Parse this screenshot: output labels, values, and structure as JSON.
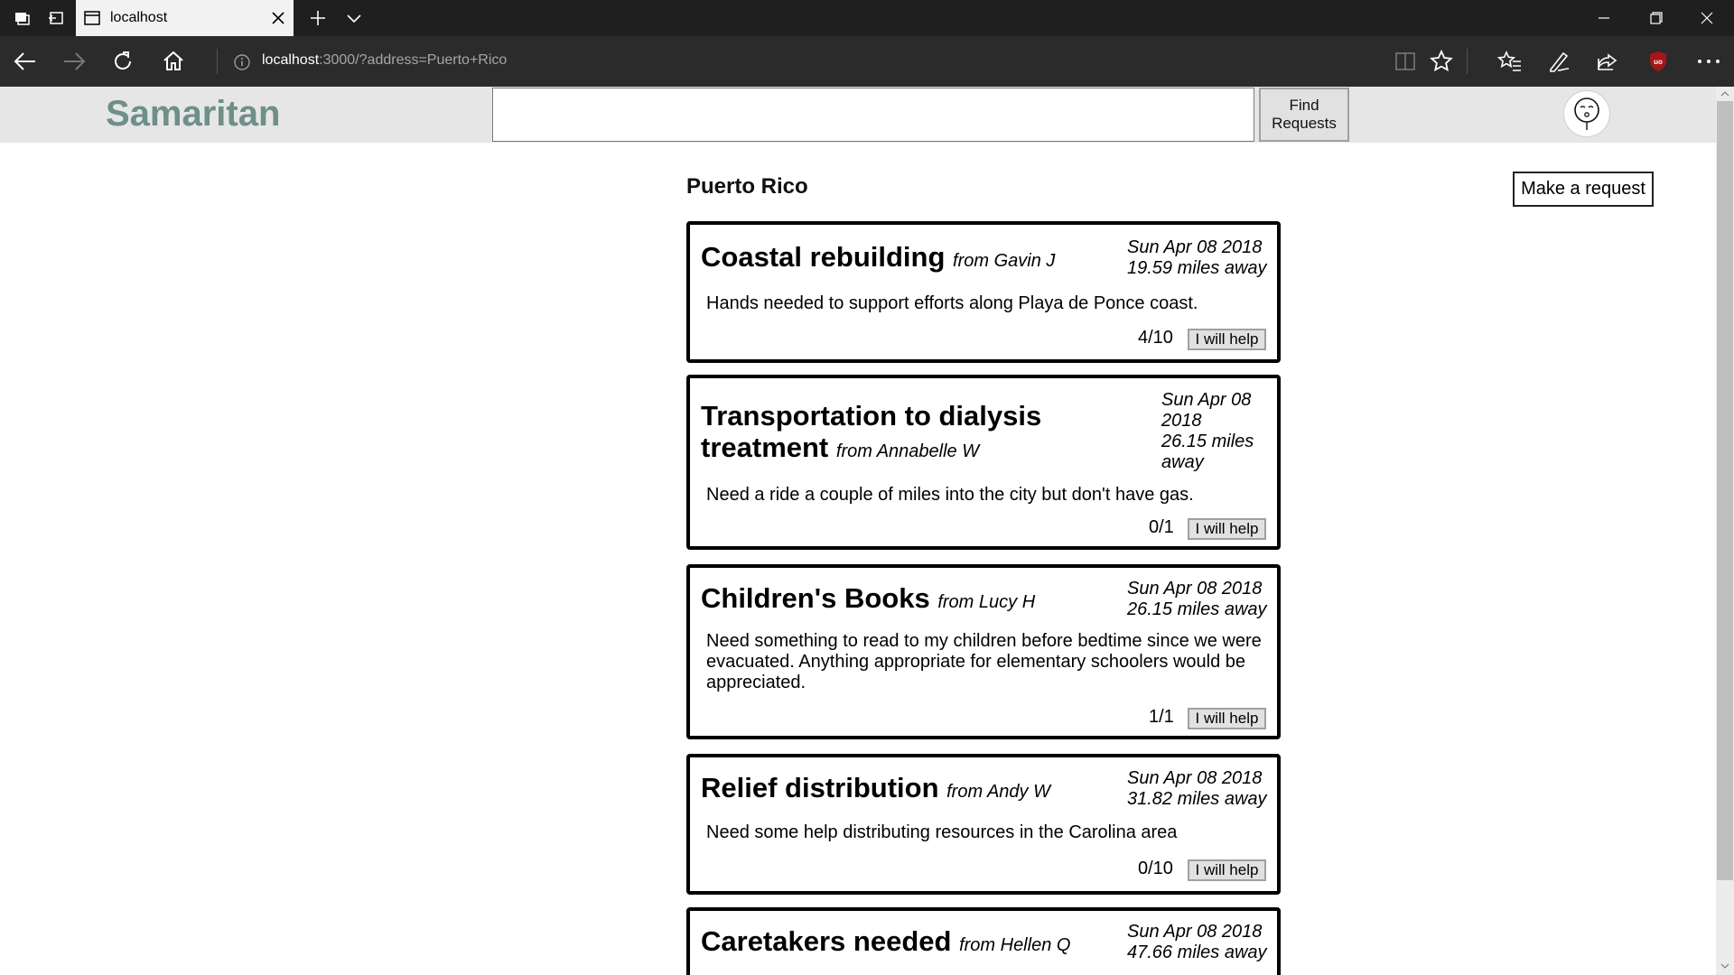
{
  "browser": {
    "tab_title": "localhost",
    "url_host": "localhost",
    "url_rest": ":3000/?address=Puerto+Rico"
  },
  "site": {
    "logo": "Samaritan",
    "search_value": "",
    "find_button": "Find\nRequests",
    "location": "Puerto Rico",
    "make_request": "Make a request"
  },
  "requests": [
    {
      "title": "Coastal rebuilding",
      "from": "from Gavin J",
      "date": "Sun Apr 08 2018",
      "distance": "19.59 miles away",
      "description": "Hands needed to support efforts along Playa de Ponce coast.",
      "count": "4/10",
      "help_label": "I will help"
    },
    {
      "title_line1": "Transportation to dialysis",
      "title_line2": "treatment",
      "from": "from Annabelle W",
      "date_line1": "Sun Apr 08",
      "date_line2": "2018",
      "distance_line1": "26.15 miles",
      "distance_line2": "away",
      "description": "Need a ride a couple of miles into the city but don't have gas.",
      "count": "0/1",
      "help_label": "I will help"
    },
    {
      "title": "Children's Books",
      "from": "from Lucy H",
      "date": "Sun Apr 08 2018",
      "distance": "26.15 miles away",
      "description": "Need something to read to my children before bedtime since we were evacuated. Anything appropriate for elementary schoolers would be appreciated.",
      "count": "1/1",
      "help_label": "I will help"
    },
    {
      "title": "Relief distribution",
      "from": "from Andy W",
      "date": "Sun Apr 08 2018",
      "distance": "31.82 miles away",
      "description": "Need some help distributing resources in the Carolina area",
      "count": "0/10",
      "help_label": "I will help"
    },
    {
      "title": "Caretakers needed",
      "from": "from Hellen Q",
      "date": "Sun Apr 08 2018",
      "distance": "47.66 miles away"
    }
  ]
}
